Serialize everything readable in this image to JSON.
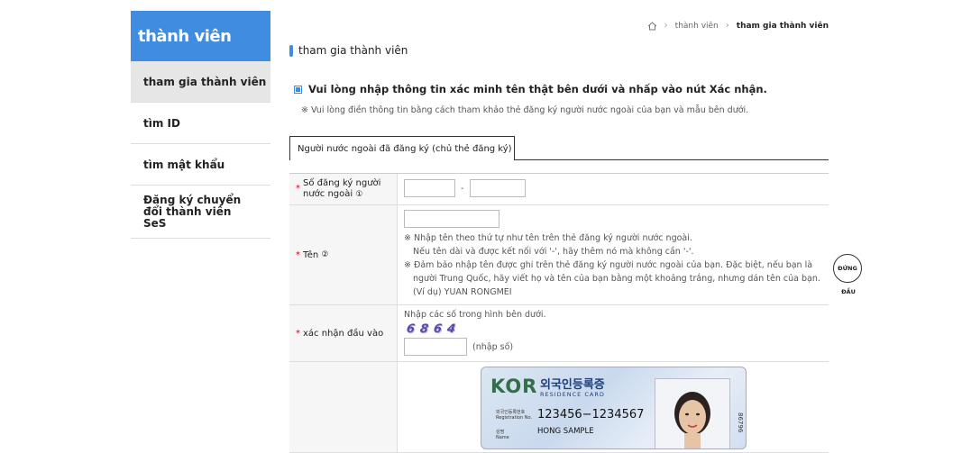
{
  "sidebar": {
    "title": "thành viên",
    "items": [
      {
        "label": "tham gia thành viên",
        "active": true
      },
      {
        "label": "tìm ID",
        "active": false
      },
      {
        "label": "tìm mật khẩu",
        "active": false
      },
      {
        "label": "Đăng ký chuyển đổi thành viên SeS",
        "active": false
      }
    ]
  },
  "breadcrumb": {
    "home_icon": "home-icon",
    "items": [
      "thành viên",
      "tham gia thành viên"
    ]
  },
  "page": {
    "title": "tham gia thành viên",
    "instruction": "Vui lòng nhập thông tin xác minh tên thật bên dưới và nhấp vào nút Xác nhận.",
    "instruction_sub": "※ Vui lòng điền thông tin bằng cách tham khảo thẻ đăng ký người nước ngoài của bạn và mẫu bên dưới."
  },
  "tab": {
    "label": "Người nước ngoài đã đăng ký (chủ thẻ đăng ký)"
  },
  "form": {
    "reg_label": "Số đăng ký người nước ngoài",
    "reg_circle": "①",
    "reg_sep": "-",
    "name_label": "Tên",
    "name_circle": "②",
    "name_note1": "※ Nhập tên theo thứ tự như tên trên thẻ đăng ký người nước ngoài.",
    "name_note2": "Nếu tên dài và được kết nối với '-', hãy thêm nó mà không cần '-'.",
    "name_note3": "※ Đảm bảo nhập tên được ghi trên thẻ đăng ký người nước ngoài của bạn. Đặc biệt, nếu bạn là",
    "name_note4": "người Trung Quốc, hãy viết họ và tên của bạn bằng một khoảng trắng, nhưng dán tên của bạn.",
    "name_note5": "(Ví dụ) YUAN RONGMEI",
    "captcha_label": "xác nhận đầu vào",
    "captcha_hint": "Nhập các số trong hình bên dưới.",
    "captcha_digits": [
      "6",
      "8",
      "6",
      "4"
    ],
    "captcha_suffix": "(nhập số)"
  },
  "card": {
    "kor": "KOR",
    "title_kr": "외국인등록증",
    "title_en": "RESIDENCE CARD",
    "reg_label": "외국인등록번호",
    "reg_label_en": "Registration No.",
    "reg_no": "123456−1234567",
    "name_label": "성명",
    "name_label_en": "Name",
    "name": "HONG SAMPLE",
    "vertical": "86796"
  },
  "float_button": {
    "label": "ĐỨNG",
    "caption": "ĐẦU"
  },
  "colors": {
    "accent": "#3f8ce0",
    "required": "#d0021b"
  }
}
